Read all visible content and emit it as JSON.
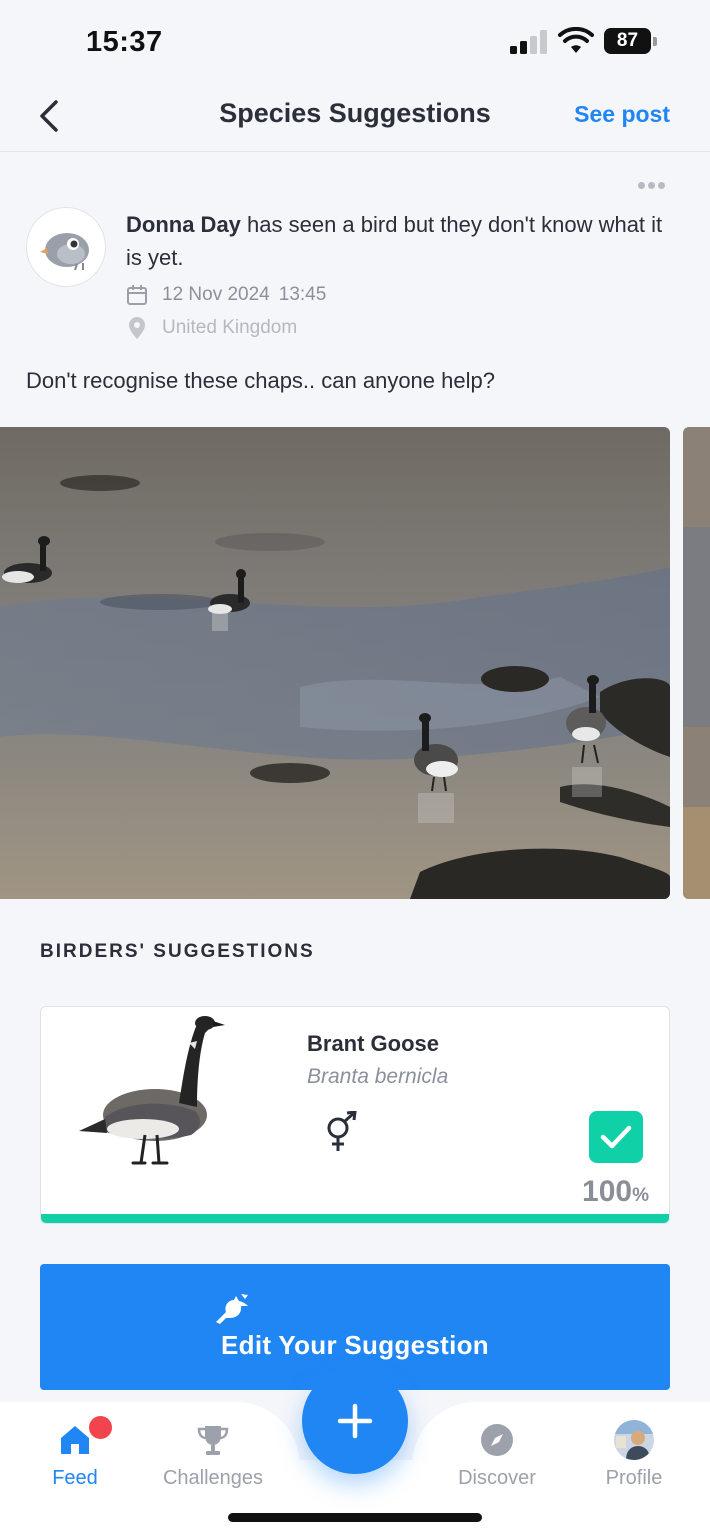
{
  "status_bar": {
    "time": "15:37",
    "battery": "87"
  },
  "nav": {
    "title": "Species Suggestions",
    "see_post_label": "See post"
  },
  "post": {
    "author": "Donna Day",
    "message": " has seen a bird but they don't know what it is yet.",
    "date": "12 Nov 2024",
    "time": "13:45",
    "location": "United Kingdom",
    "caption": "Don't recognise these chaps..  can anyone help?"
  },
  "suggestions": {
    "section_label": "BIRDERS' SUGGESTIONS",
    "items": [
      {
        "common_name": "Brant Goose",
        "scientific_name": "Branta bernicla",
        "percent": "100",
        "percent_unit": "%",
        "agreement_fraction": 1.0
      }
    ]
  },
  "edit_button": {
    "label": "Edit Your Suggestion"
  },
  "tab_bar": {
    "tabs": [
      {
        "label": "Feed",
        "icon": "home-icon",
        "active": true
      },
      {
        "label": "Challenges",
        "icon": "trophy-icon",
        "active": false
      },
      {
        "label": "Discover",
        "icon": "compass-icon",
        "active": false
      },
      {
        "label": "Profile",
        "icon": "avatar",
        "active": false
      }
    ]
  },
  "colors": {
    "accent": "#1f86f3",
    "success": "#13cfa5",
    "notification": "#f1444c"
  }
}
